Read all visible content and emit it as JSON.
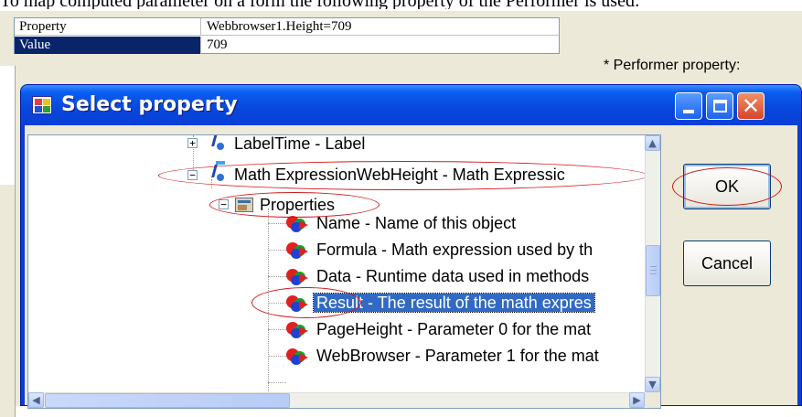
{
  "top_caption": "To map computed parameter on a form the following property of the Performer is used:",
  "property_grid": {
    "rows": [
      {
        "key": "Property",
        "value": "Webbrowser1.Height=709"
      },
      {
        "key": "Value",
        "value": "709"
      }
    ]
  },
  "side_label": "* Performer property:",
  "dialog": {
    "title": "Select property",
    "buttons": {
      "ok": "OK",
      "cancel": "Cancel"
    },
    "tree": {
      "nodes": [
        {
          "label": "LabelTime - Label",
          "expander": "+",
          "icon": "component-icon"
        },
        {
          "label": "Math ExpressionWebHeight - Math Expressic",
          "expander": "−",
          "icon": "component-icon"
        },
        {
          "label": "Properties",
          "expander": "−",
          "icon": "properties-icon"
        },
        {
          "label": "Name - Name of this object",
          "icon": "property-icon"
        },
        {
          "label": "Formula - Math expression used by th",
          "icon": "property-icon"
        },
        {
          "label": "Data - Runtime data used in methods",
          "icon": "property-icon"
        },
        {
          "label": "Result - The result of the math expres",
          "icon": "property-icon",
          "selected": true
        },
        {
          "label": "PageHeight - Parameter 0 for the mat",
          "icon": "property-icon"
        },
        {
          "label": "WebBrowser - Parameter 1 for the mat",
          "icon": "property-icon"
        }
      ]
    },
    "scrollbar_glyphs": {
      "up": "▲",
      "down": "▼",
      "left": "◀",
      "right": "▶"
    }
  },
  "colors": {
    "titlebar": "#0a5ef0",
    "selection": "#316ac5",
    "annotation": "#d01818"
  }
}
